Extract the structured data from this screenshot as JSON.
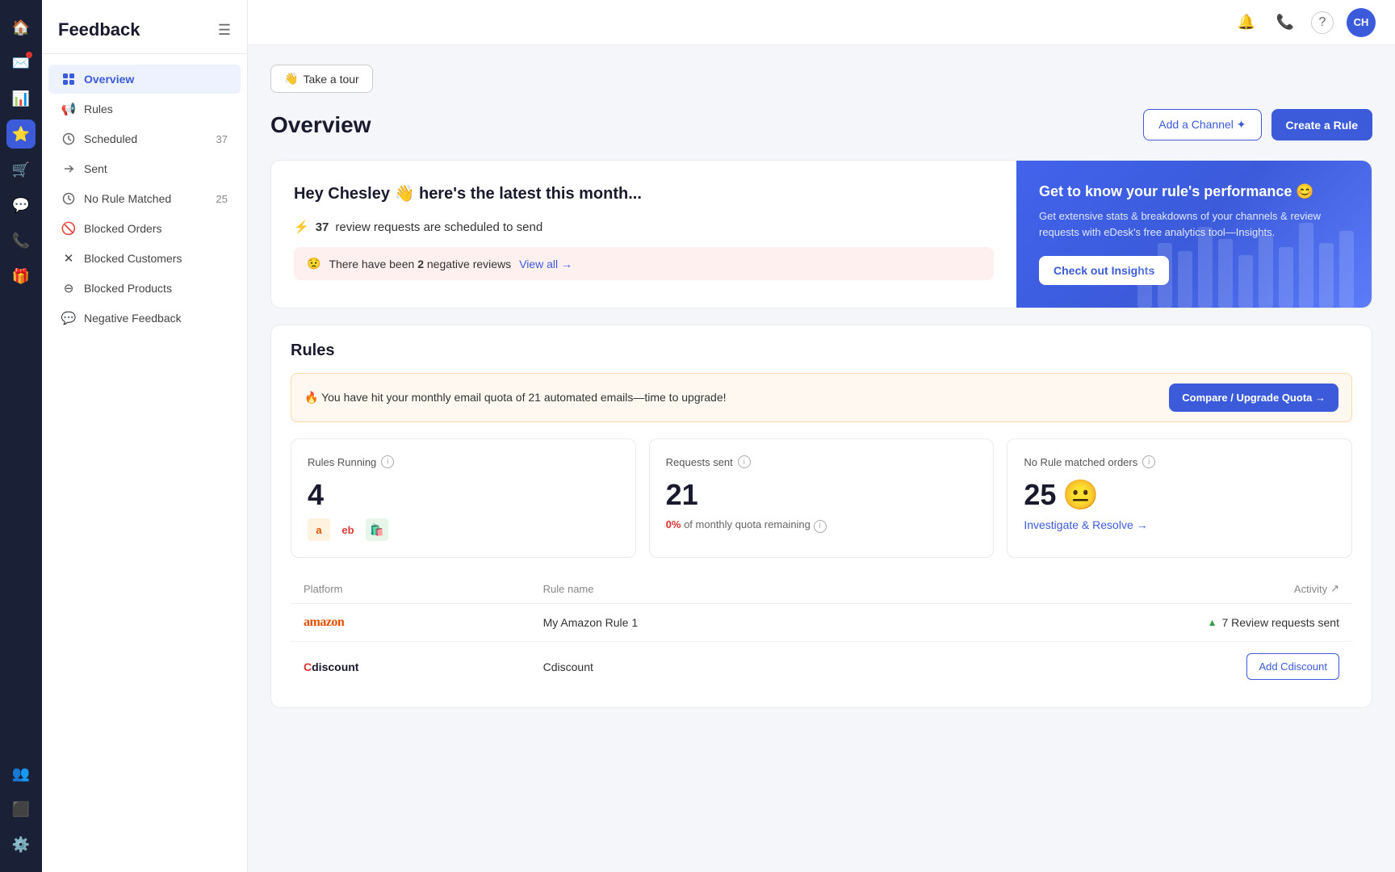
{
  "app": {
    "title": "Feedback"
  },
  "top_header": {
    "avatar_initials": "CH",
    "notification_icon": "🔔",
    "phone_icon": "📞",
    "help_icon": "?"
  },
  "sidebar": {
    "title": "Feedback",
    "nav_items": [
      {
        "id": "overview",
        "label": "Overview",
        "icon": "grid",
        "active": true,
        "count": ""
      },
      {
        "id": "rules",
        "label": "Rules",
        "icon": "megaphone",
        "active": false,
        "count": ""
      },
      {
        "id": "scheduled",
        "label": "Scheduled",
        "icon": "clock",
        "active": false,
        "count": "37"
      },
      {
        "id": "sent",
        "label": "Sent",
        "icon": "arrow-right",
        "active": false,
        "count": ""
      },
      {
        "id": "no-rule-matched",
        "label": "No Rule Matched",
        "icon": "clock",
        "active": false,
        "count": "25"
      },
      {
        "id": "blocked-orders",
        "label": "Blocked Orders",
        "icon": "block",
        "active": false,
        "count": ""
      },
      {
        "id": "blocked-customers",
        "label": "Blocked Customers",
        "icon": "x",
        "active": false,
        "count": ""
      },
      {
        "id": "blocked-products",
        "label": "Blocked Products",
        "icon": "minus",
        "active": false,
        "count": ""
      },
      {
        "id": "negative-feedback",
        "label": "Negative Feedback",
        "icon": "comment",
        "active": false,
        "count": ""
      }
    ]
  },
  "tour_button": {
    "label": "Take a tour",
    "emoji": "👋"
  },
  "page": {
    "title": "Overview"
  },
  "header_actions": {
    "add_channel": "Add a Channel ✦",
    "create_rule": "Create a Rule"
  },
  "hey_section": {
    "greeting": "Hey Chesley 👋 here's the latest this month...",
    "scheduled_count": "37",
    "scheduled_text": "review requests are scheduled to send",
    "scheduled_emoji": "⚡",
    "negative_emoji": "😟",
    "negative_text": "There have been",
    "negative_count": "2",
    "negative_suffix": "negative reviews",
    "view_all": "View all →"
  },
  "insights_card": {
    "title": "Get to know your rule's performance 😊",
    "description": "Get extensive stats & breakdowns of your channels & review requests with eDesk's free analytics tool—Insights.",
    "button": "Check out Insights"
  },
  "rules_section": {
    "title": "Rules",
    "quota_warning": "🔥 You have hit your monthly email quota of",
    "quota_highlight": "21 automated emails",
    "quota_suffix": "—time to upgrade!",
    "upgrade_btn": "Compare / Upgrade Quota →",
    "stats": [
      {
        "id": "rules-running",
        "title": "Rules Running",
        "value": "4",
        "sub": ""
      },
      {
        "id": "requests-sent",
        "title": "Requests sent",
        "value": "21",
        "sub": "0% of monthly quota remaining"
      },
      {
        "id": "no-rule-matched",
        "title": "No Rule matched orders",
        "value": "25",
        "emoji": "😐",
        "sub": ""
      }
    ],
    "investigate_link": "Investigate & Resolve →",
    "table": {
      "headers": [
        "Platform",
        "Rule name",
        "Activity"
      ],
      "rows": [
        {
          "platform": "amazon",
          "platform_display": "amazon",
          "rule_name": "My Amazon Rule 1",
          "activity": "7 Review requests sent",
          "activity_arrow": "↑"
        },
        {
          "platform": "cdiscount",
          "platform_display": "Cdiscount",
          "rule_name": "Cdiscount",
          "action_btn": "Add Cdiscount"
        }
      ]
    }
  }
}
